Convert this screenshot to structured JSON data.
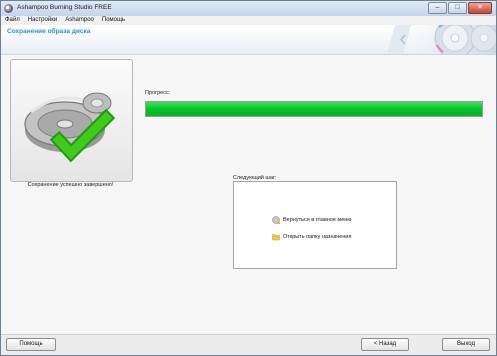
{
  "window": {
    "title": "Ashampoo Burning Studio FREE",
    "controls": {
      "minimize_icon": "minimize-icon",
      "maximize_icon": "maximize-icon",
      "close_icon": "close-icon"
    }
  },
  "menu": {
    "items": [
      {
        "label": "Файл"
      },
      {
        "label": "Настройки"
      },
      {
        "label": "Ashampoo"
      },
      {
        "label": "Помощь"
      }
    ]
  },
  "header": {
    "title": "Сохранение образа диска"
  },
  "main": {
    "status_text": "Сохранение успешно завершено!",
    "progress_label": "Прогресс:",
    "progress_value": 1.0,
    "next_step_label": "Следующий шаг:",
    "next_items": [
      {
        "label": "Вернуться в главное меню",
        "icon": "home-disc-icon"
      },
      {
        "label": "Открыть папку назначения",
        "icon": "folder-icon"
      }
    ]
  },
  "buttons": {
    "help": "Помощь",
    "back": "< Назад",
    "exit": "Выход"
  },
  "colors": {
    "accent": "#2f8fd8",
    "progress": "#05c42a",
    "checkmark": "#31c414"
  }
}
